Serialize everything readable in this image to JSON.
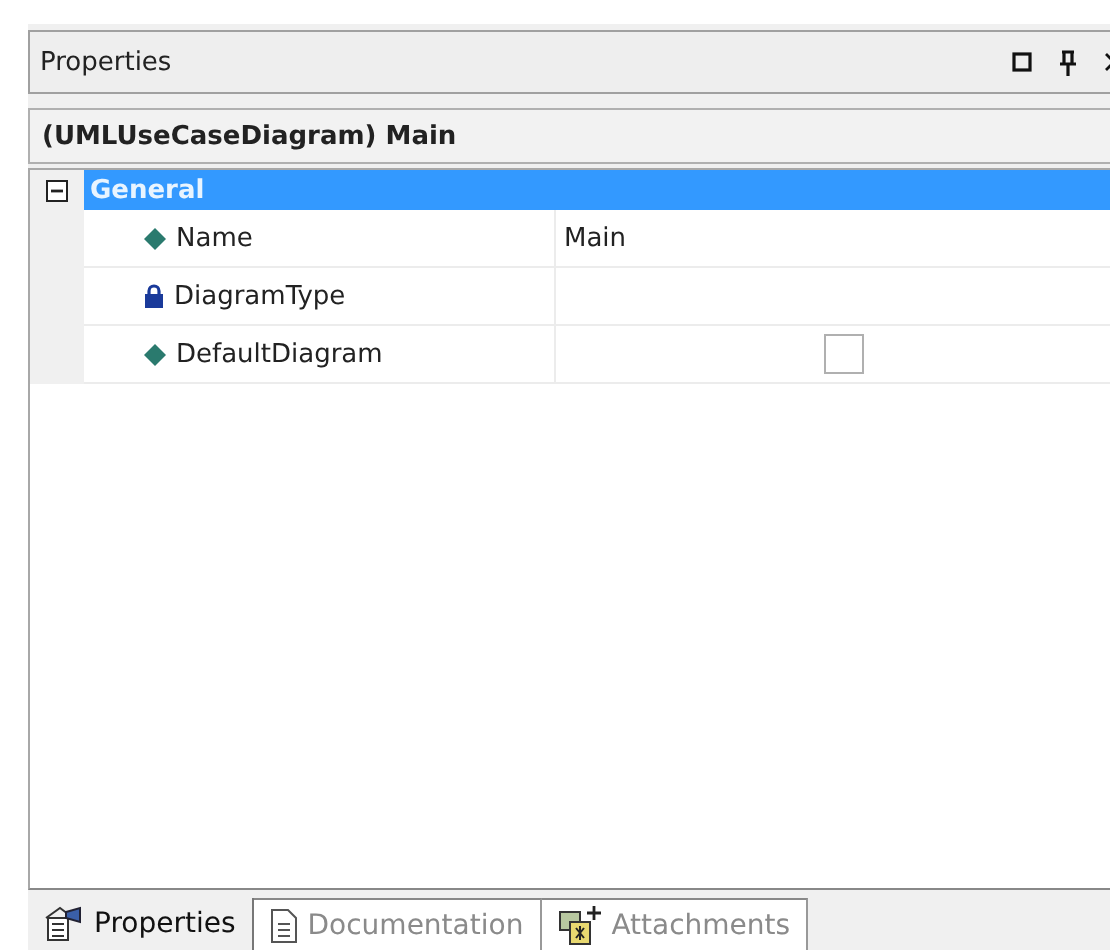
{
  "panel": {
    "title": "Properties",
    "buttons": [
      {
        "kind": "restore"
      },
      {
        "kind": "pin"
      },
      {
        "kind": "close"
      }
    ]
  },
  "header": "(UMLUseCaseDiagram) Main",
  "grid": {
    "category": {
      "label": "General",
      "expanded": true,
      "selected": true
    },
    "rows": [
      {
        "name": "Name",
        "kind": "editable",
        "value": "Main"
      },
      {
        "name": "DiagramType",
        "kind": "readonly"
      },
      {
        "name": "DefaultDiagram",
        "kind": "editable",
        "checked": false
      }
    ]
  },
  "tabs": [
    {
      "label": "Properties",
      "selected": true
    },
    {
      "label": "Documentation",
      "selected": false
    },
    {
      "label": "Attachments",
      "selected": false
    }
  ]
}
